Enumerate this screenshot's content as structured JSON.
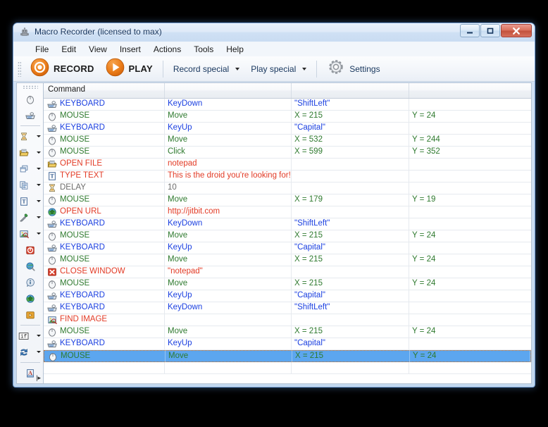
{
  "window": {
    "title": "Macro Recorder (licensed to max)",
    "app_icon": "robot-icon",
    "buttons": {
      "minimize": "minimize-button",
      "maximize": "maximize-button",
      "close": "close-button"
    }
  },
  "menubar": {
    "items": [
      "File",
      "Edit",
      "View",
      "Insert",
      "Actions",
      "Tools",
      "Help"
    ]
  },
  "toolbar": {
    "record_label": "RECORD",
    "play_label": "PLAY",
    "record_special_label": "Record special",
    "play_special_label": "Play special",
    "settings_label": "Settings"
  },
  "sidebar": {
    "items": [
      {
        "name": "mouse-icon",
        "caret": false
      },
      {
        "name": "keyboard-icon",
        "caret": false
      },
      {
        "name": "separator",
        "caret": false
      },
      {
        "name": "delay-hourglass-icon",
        "caret": true
      },
      {
        "name": "open-file-icon",
        "caret": true
      },
      {
        "name": "window-icon",
        "caret": true
      },
      {
        "name": "copy-clipboard-icon",
        "caret": true
      },
      {
        "name": "type-text-icon",
        "caret": true
      },
      {
        "name": "color-picker-icon",
        "caret": true
      },
      {
        "name": "find-image-icon",
        "caret": true
      },
      {
        "name": "stop-icon",
        "caret": false
      },
      {
        "name": "globe-icon",
        "caret": false
      },
      {
        "name": "info-icon",
        "caret": false
      },
      {
        "name": "open-url-icon",
        "caret": false
      },
      {
        "name": "run-icon",
        "caret": false
      },
      {
        "name": "separator",
        "caret": false
      },
      {
        "name": "if-condition-icon",
        "caret": true,
        "label": "if"
      },
      {
        "name": "loop-icon",
        "caret": true
      },
      {
        "name": "separator",
        "caret": false
      },
      {
        "name": "text-anchor-icon",
        "caret": false
      }
    ],
    "expand_label": "|▸"
  },
  "grid": {
    "headers": [
      "Command",
      "",
      "",
      ""
    ],
    "rows": [
      {
        "icon": "keyboard-icon",
        "command": "KEYBOARD",
        "color": "blue",
        "arg": "KeyDown",
        "arg_color": "blue",
        "x": "\"ShiftLeft\"",
        "x_color": "blue",
        "y": ""
      },
      {
        "icon": "mouse-icon",
        "command": "MOUSE",
        "color": "green",
        "arg": "Move",
        "arg_color": "green",
        "x": "X = 215",
        "x_color": "green",
        "y": "Y = 24",
        "y_color": "green"
      },
      {
        "icon": "keyboard-icon",
        "command": "KEYBOARD",
        "color": "blue",
        "arg": "KeyUp",
        "arg_color": "blue",
        "x": "\"Capital\"",
        "x_color": "blue",
        "y": ""
      },
      {
        "icon": "mouse-icon",
        "command": "MOUSE",
        "color": "green",
        "arg": "Move",
        "arg_color": "green",
        "x": "X = 532",
        "x_color": "green",
        "y": "Y = 244",
        "y_color": "green"
      },
      {
        "icon": "mouse-icon",
        "command": "MOUSE",
        "color": "green",
        "arg": "Click",
        "arg_color": "green",
        "x": "X = 599",
        "x_color": "green",
        "y": "Y = 352",
        "y_color": "green"
      },
      {
        "icon": "open-file-icon",
        "command": "OPEN FILE",
        "color": "red",
        "arg": "notepad",
        "arg_color": "red",
        "x": "",
        "y": ""
      },
      {
        "icon": "type-text-icon",
        "command": "TYPE TEXT",
        "color": "red",
        "arg": "This is the droid you're looking for!",
        "arg_color": "red",
        "x": "",
        "y": ""
      },
      {
        "icon": "delay-hourglass-icon",
        "command": "DELAY",
        "color": "gray",
        "arg": "10",
        "arg_color": "gray",
        "x": "",
        "y": ""
      },
      {
        "icon": "mouse-icon",
        "command": "MOUSE",
        "color": "green",
        "arg": "Move",
        "arg_color": "green",
        "x": "X = 179",
        "x_color": "green",
        "y": "Y = 19",
        "y_color": "green"
      },
      {
        "icon": "open-url-icon",
        "command": "OPEN URL",
        "color": "red",
        "arg": "http://jitbit.com",
        "arg_color": "red",
        "x": "",
        "y": ""
      },
      {
        "icon": "keyboard-icon",
        "command": "KEYBOARD",
        "color": "blue",
        "arg": "KeyDown",
        "arg_color": "blue",
        "x": "\"ShiftLeft\"",
        "x_color": "blue",
        "y": ""
      },
      {
        "icon": "mouse-icon",
        "command": "MOUSE",
        "color": "green",
        "arg": "Move",
        "arg_color": "green",
        "x": "X = 215",
        "x_color": "green",
        "y": "Y = 24",
        "y_color": "green"
      },
      {
        "icon": "keyboard-icon",
        "command": "KEYBOARD",
        "color": "blue",
        "arg": "KeyUp",
        "arg_color": "blue",
        "x": "\"Capital\"",
        "x_color": "blue",
        "y": ""
      },
      {
        "icon": "mouse-icon",
        "command": "MOUSE",
        "color": "green",
        "arg": "Move",
        "arg_color": "green",
        "x": "X = 215",
        "x_color": "green",
        "y": "Y = 24",
        "y_color": "green"
      },
      {
        "icon": "close-window-icon",
        "command": "CLOSE WINDOW",
        "color": "red",
        "arg": "\"notepad\"",
        "arg_color": "red",
        "x": "",
        "y": ""
      },
      {
        "icon": "mouse-icon",
        "command": "MOUSE",
        "color": "green",
        "arg": "Move",
        "arg_color": "green",
        "x": "X = 215",
        "x_color": "green",
        "y": "Y = 24",
        "y_color": "green"
      },
      {
        "icon": "keyboard-icon",
        "command": "KEYBOARD",
        "color": "blue",
        "arg": "KeyUp",
        "arg_color": "blue",
        "x": "\"Capital\"",
        "x_color": "blue",
        "y": ""
      },
      {
        "icon": "keyboard-icon",
        "command": "KEYBOARD",
        "color": "blue",
        "arg": "KeyDown",
        "arg_color": "blue",
        "x": "\"ShiftLeft\"",
        "x_color": "blue",
        "y": ""
      },
      {
        "icon": "find-image-icon",
        "command": "FIND IMAGE",
        "color": "red",
        "arg": "",
        "x": "",
        "y": ""
      },
      {
        "icon": "mouse-icon",
        "command": "MOUSE",
        "color": "green",
        "arg": "Move",
        "arg_color": "green",
        "x": "X = 215",
        "x_color": "green",
        "y": "Y = 24",
        "y_color": "green"
      },
      {
        "icon": "keyboard-icon",
        "command": "KEYBOARD",
        "color": "blue",
        "arg": "KeyUp",
        "arg_color": "blue",
        "x": "\"Capital\"",
        "x_color": "blue",
        "y": ""
      },
      {
        "icon": "mouse-icon",
        "command": "MOUSE",
        "color": "green",
        "arg": "Move",
        "arg_color": "green",
        "x": "X = 215",
        "x_color": "green",
        "y": "Y = 24",
        "y_color": "green",
        "selected": true
      }
    ]
  },
  "colors": {
    "accent_orange": "#e8791a",
    "selection_blue": "#5ca6ef",
    "command_blue": "#1a3fe0",
    "command_green": "#2f7a2f",
    "command_red": "#e23b26",
    "command_gray": "#6c6c6c"
  }
}
